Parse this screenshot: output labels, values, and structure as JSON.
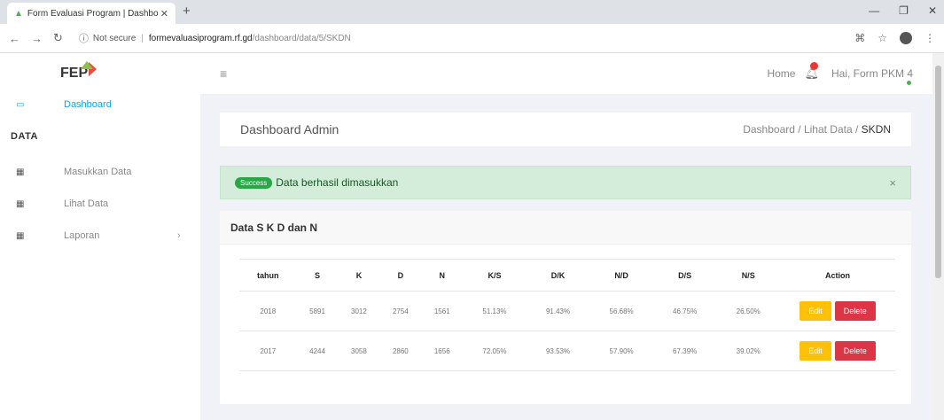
{
  "browser": {
    "tab_title": "Form Evaluasi Program | Dashbo",
    "url_notice": "Not secure",
    "url_domain": "formevaluasiprogram.rf.gd",
    "url_path": "/dashboard/data/5/SKDN"
  },
  "sidebar": {
    "logo": "FEP",
    "dashboard_label": "Dashboard",
    "section_label": "DATA",
    "items": [
      {
        "label": "Masukkan Data"
      },
      {
        "label": "Lihat Data"
      },
      {
        "label": "Laporan"
      }
    ]
  },
  "header": {
    "home_label": "Home",
    "user_label": "Hai, Form PKM 4"
  },
  "page": {
    "title": "Dashboard Admin",
    "breadcrumb": [
      "Dashboard",
      "Lihat Data",
      "SKDN"
    ]
  },
  "alert": {
    "badge": "Success",
    "message": "Data berhasil dimasukkan",
    "close": "×"
  },
  "table": {
    "title": "Data S K D dan N",
    "headers": [
      "tahun",
      "S",
      "K",
      "D",
      "N",
      "K/S",
      "D/K",
      "N/D",
      "D/S",
      "N/S",
      "Action"
    ],
    "rows": [
      [
        "2018",
        "5891",
        "3012",
        "2754",
        "1561",
        "51.13%",
        "91.43%",
        "56.68%",
        "46.75%",
        "26.50%"
      ],
      [
        "2017",
        "4244",
        "3058",
        "2860",
        "1656",
        "72.05%",
        "93.53%",
        "57.90%",
        "67.39%",
        "39.02%"
      ]
    ],
    "edit_label": "Edit",
    "delete_label": "Delete"
  },
  "colors": {
    "accent": "#03a9f4",
    "success": "#28a745",
    "edit": "#ffc107",
    "delete": "#dc3545"
  }
}
